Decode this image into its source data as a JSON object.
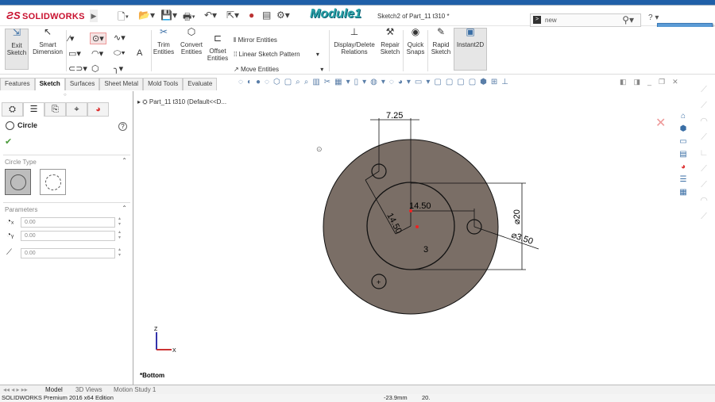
{
  "app": {
    "brand": "SOLIDWORKS",
    "module_watermark": "Module1",
    "document_title": "Sketch2 of Part_11 t310 *",
    "part_badge": "Part11"
  },
  "search": {
    "value": "new"
  },
  "ribbon": {
    "exit_sketch": "Exit Sketch",
    "smart_dimension": "Smart Dimension",
    "trim_entities": "Trim Entities",
    "convert_entities": "Convert Entities",
    "offset_entities": "Offset Entities",
    "mirror_entities": "Mirror Entities",
    "linear_sketch_pattern": "Linear Sketch Pattern",
    "move_entities": "Move Entities",
    "display_delete_relations": "Display/Delete Relations",
    "repair_sketch": "Repair Sketch",
    "quick_snaps": "Quick Snaps",
    "rapid_sketch": "Rapid Sketch",
    "instant2d": "Instant2D"
  },
  "tabs": [
    "Features",
    "Sketch",
    "Surfaces",
    "Sheet Metal",
    "Mold Tools",
    "Evaluate"
  ],
  "property_manager": {
    "title": "Circle",
    "circle_type_label": "Circle Type",
    "parameters_label": "Parameters",
    "params": [
      {
        "icon": "center-x-icon",
        "value": "0.00"
      },
      {
        "icon": "center-y-icon",
        "value": "0.00"
      },
      {
        "icon": "radius-icon",
        "value": "0.00"
      }
    ]
  },
  "tree": {
    "root": "Part_11 t310  (Default<<D..."
  },
  "sketch": {
    "dimensions": {
      "top": "7.25",
      "horizontal": "14.50",
      "diagonal": "14.50",
      "inner_diameter": "⌀20",
      "hole_diameter": "⌀3.50",
      "pattern_count": "3"
    },
    "fill_color": "#7a6e66"
  },
  "view": {
    "orientation": "*Bottom",
    "axis_z": "Z",
    "axis_x": "X"
  },
  "bottom_tabs": [
    "Model",
    "3D Views",
    "Motion Study 1"
  ],
  "status": {
    "edition": "SOLIDWORKS Premium 2016 x64 Edition",
    "coord": "-23.9mm",
    "coord2": "20."
  }
}
